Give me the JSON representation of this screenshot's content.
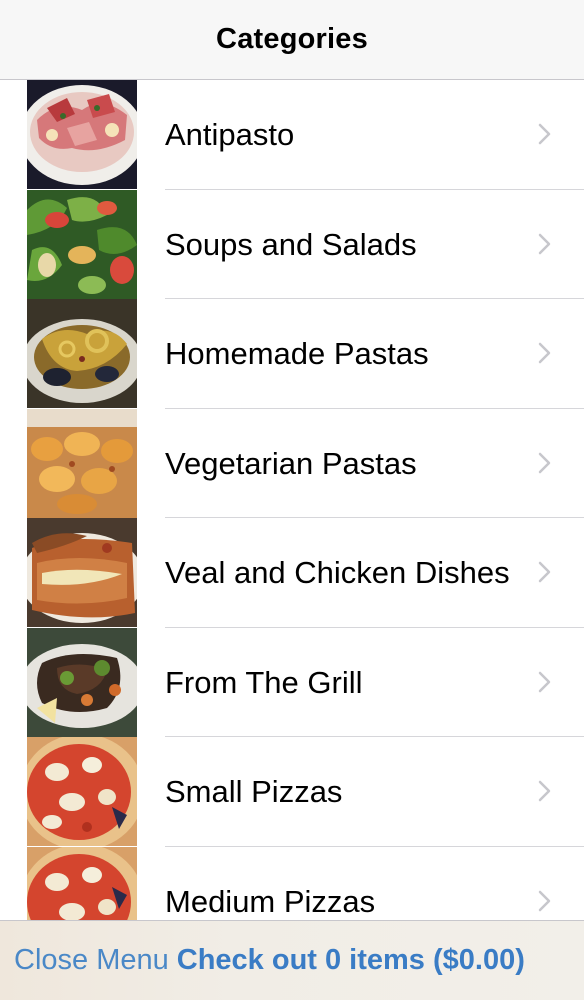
{
  "navbar": {
    "title": "Categories"
  },
  "categories": [
    {
      "label": "Antipasto",
      "thumb_icon": "antipasto-photo"
    },
    {
      "label": "Soups and Salads",
      "thumb_icon": "salad-photo"
    },
    {
      "label": "Homemade Pastas",
      "thumb_icon": "pasta-photo"
    },
    {
      "label": "Vegetarian Pastas",
      "thumb_icon": "vegetarian-pasta-photo"
    },
    {
      "label": "Veal and Chicken Dishes",
      "thumb_icon": "veal-chicken-photo"
    },
    {
      "label": "From The Grill",
      "thumb_icon": "grill-photo"
    },
    {
      "label": "Small Pizzas",
      "thumb_icon": "small-pizza-photo"
    },
    {
      "label": "Medium Pizzas",
      "thumb_icon": "medium-pizza-photo"
    }
  ],
  "bottombar": {
    "close_label": "Close Menu",
    "checkout_label": "Check out 0 items ($0.00)"
  },
  "colors": {
    "link": "#4a88c7",
    "link_bold": "#3a7cc5",
    "chevron": "#c7c7cc",
    "separator": "#d6d6da"
  }
}
